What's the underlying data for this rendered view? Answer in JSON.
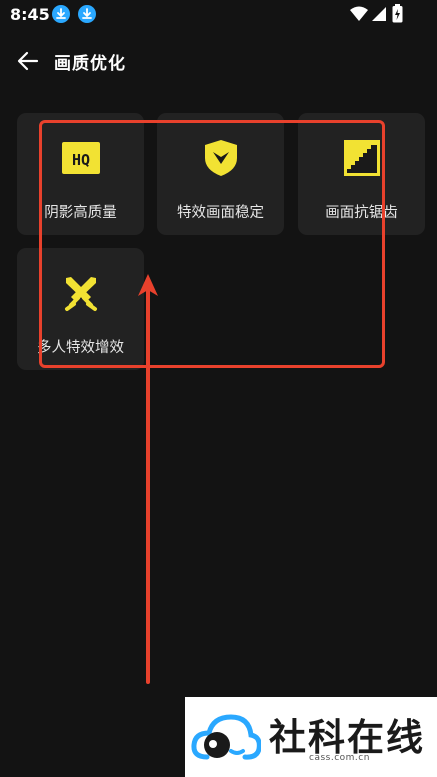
{
  "status_bar": {
    "time": "8:45"
  },
  "header": {
    "title": "画质优化"
  },
  "tiles": [
    {
      "label": "阴影高质量",
      "icon": "hq-icon"
    },
    {
      "label": "特效画面稳定",
      "icon": "shield-icon"
    },
    {
      "label": "画面抗锯齿",
      "icon": "staircase-icon"
    },
    {
      "label": "多人特效增效",
      "icon": "crossed-swords-icon"
    }
  ],
  "colors": {
    "background": "#131313",
    "tile_background": "#222222",
    "icon_yellow": "#f2e233",
    "annotation_red": "#e8412c"
  },
  "watermark": {
    "text": "社科在线",
    "subtext": "cass.com.cn"
  }
}
